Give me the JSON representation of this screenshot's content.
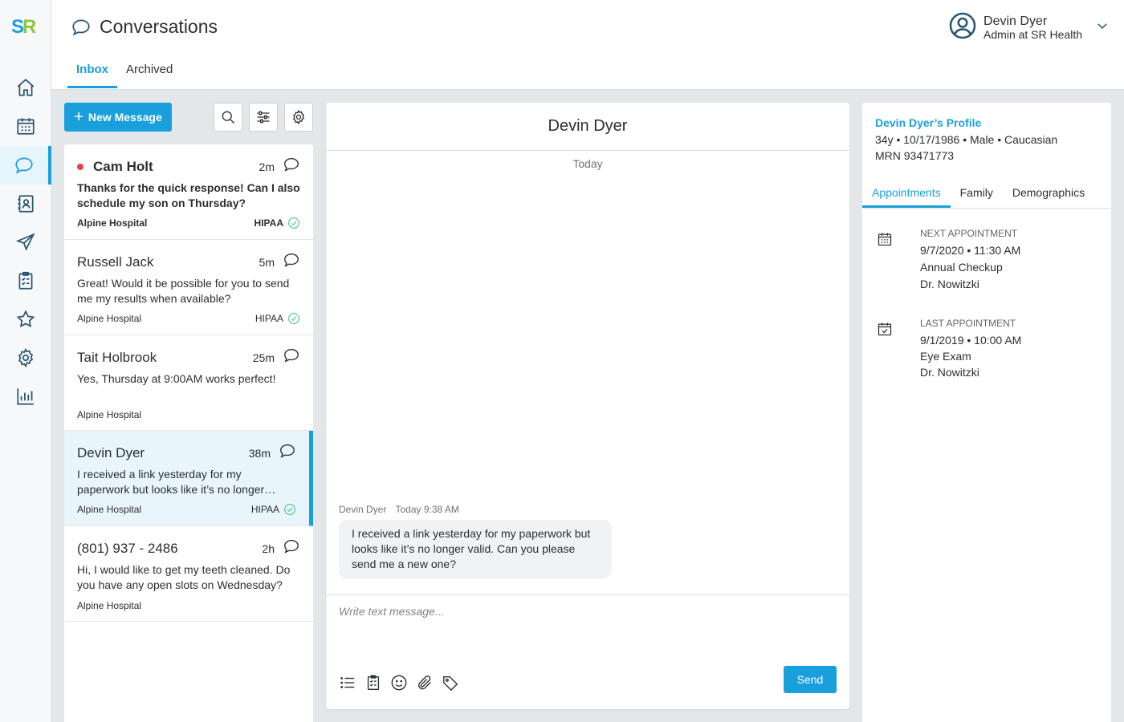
{
  "app": {
    "logo_s": "S",
    "logo_r": "R"
  },
  "header": {
    "title": "Conversations",
    "tabs": [
      {
        "label": "Inbox"
      },
      {
        "label": "Archived"
      }
    ],
    "user": {
      "name": "Devin Dyer",
      "role": "Admin at SR Health"
    }
  },
  "toolbar": {
    "new_message_label": "New Message"
  },
  "conversations": [
    {
      "name": "Cam Holt",
      "time": "2m",
      "message": "Thanks for the quick response! Can I also schedule my son on Thursday?",
      "org": "Alpine Hospital",
      "badge": "HIPAA",
      "unread": true
    },
    {
      "name": "Russell Jack",
      "time": "5m",
      "message": "Great! Would it be possible for you to send me my results when available?",
      "org": "Alpine Hospital",
      "badge": "HIPAA"
    },
    {
      "name": "Tait Holbrook",
      "time": "25m",
      "message": "Yes, Thursday at 9:00AM works perfect!",
      "org": "Alpine Hospital"
    },
    {
      "name": "Devin Dyer",
      "time": "38m",
      "message": "I received a link yesterday for my paperwork but looks like it’s no longer…",
      "org": "Alpine Hospital",
      "badge": "HIPAA",
      "selected": true
    },
    {
      "name": "(801) 937 - 2486",
      "time": "2h",
      "message": "Hi, I would like to get my teeth cleaned. Do you have any open slots on Wednesday?",
      "org": "Alpine Hospital"
    }
  ],
  "chat": {
    "title": "Devin Dyer",
    "day_label": "Today",
    "messages": [
      {
        "sender": "Devin Dyer",
        "time": "Today 9:38 AM",
        "text": "I received a link yesterday for my paperwork but looks like it’s no longer valid. Can you please send me a new one?"
      }
    ],
    "composer_placeholder": "Write text message...",
    "send_label": "Send"
  },
  "profile": {
    "title": "Devin Dyer’s Profile",
    "details": "34y • 10/17/1986 • Male • Caucasian",
    "mrn": "MRN 93471773",
    "tabs": [
      {
        "label": "Appointments"
      },
      {
        "label": "Family"
      },
      {
        "label": "Demographics"
      }
    ],
    "next": {
      "title": "NEXT APPOINTMENT",
      "datetime": "9/7/2020 • 11:30 AM",
      "type": "Annual Checkup",
      "doctor": "Dr. Nowitzki"
    },
    "last": {
      "title": "LAST APPOINTMENT",
      "datetime": "9/1/2019 • 10:00 AM",
      "type": "Eye Exam",
      "doctor": "Dr. Nowitzki"
    }
  },
  "colors": {
    "accent": "#1a9fdd",
    "unread": "#e0444f",
    "verified": "#3cc07a",
    "logo_green": "#8dc63f"
  }
}
